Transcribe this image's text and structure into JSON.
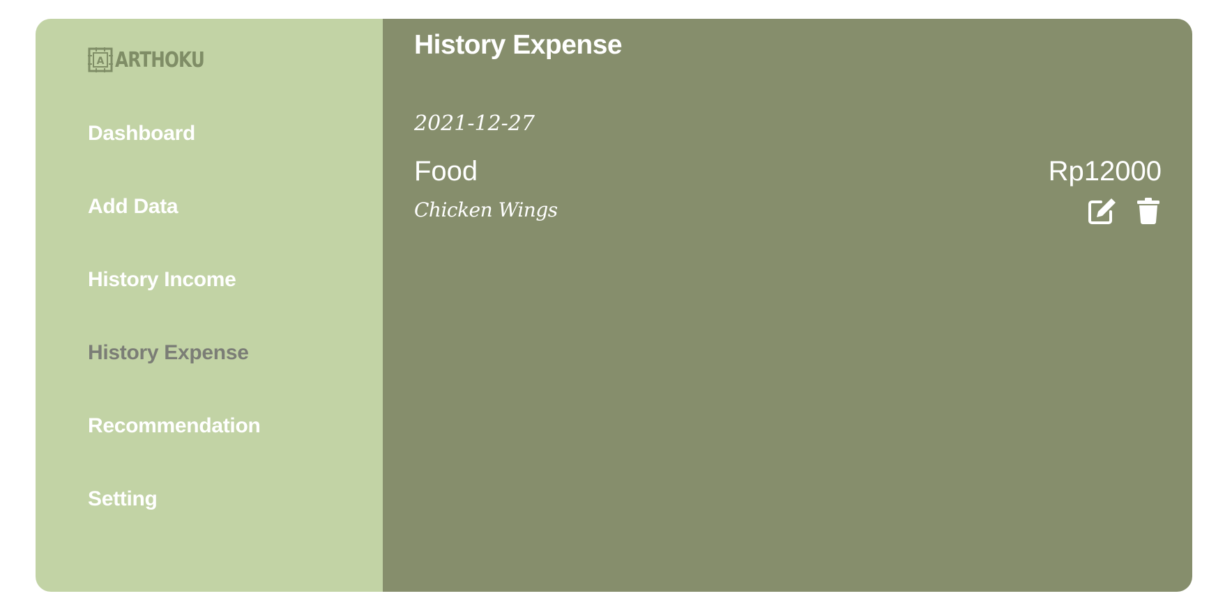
{
  "app": {
    "brand": "ARTHOKU",
    "logo_mark_letter": "A"
  },
  "sidebar": {
    "items": [
      {
        "label": "Dashboard"
      },
      {
        "label": "Add Data"
      },
      {
        "label": "History Income"
      },
      {
        "label": "History Expense",
        "active": true
      },
      {
        "label": "Recommendation"
      },
      {
        "label": "Setting"
      }
    ]
  },
  "main": {
    "title": "History Expense",
    "entries": [
      {
        "date": "2021-12-27",
        "category": "Food",
        "amount": "Rp12000",
        "note": "Chicken Wings",
        "actions": [
          {
            "icon": "edit-icon"
          },
          {
            "icon": "trash-icon"
          }
        ]
      }
    ]
  },
  "colors": {
    "sidebar_bg": "#c2d3a5",
    "main_bg": "#868e6c",
    "text": "#ffffff",
    "nav_active": "#7b7d76",
    "logo": "#7f8d66"
  }
}
